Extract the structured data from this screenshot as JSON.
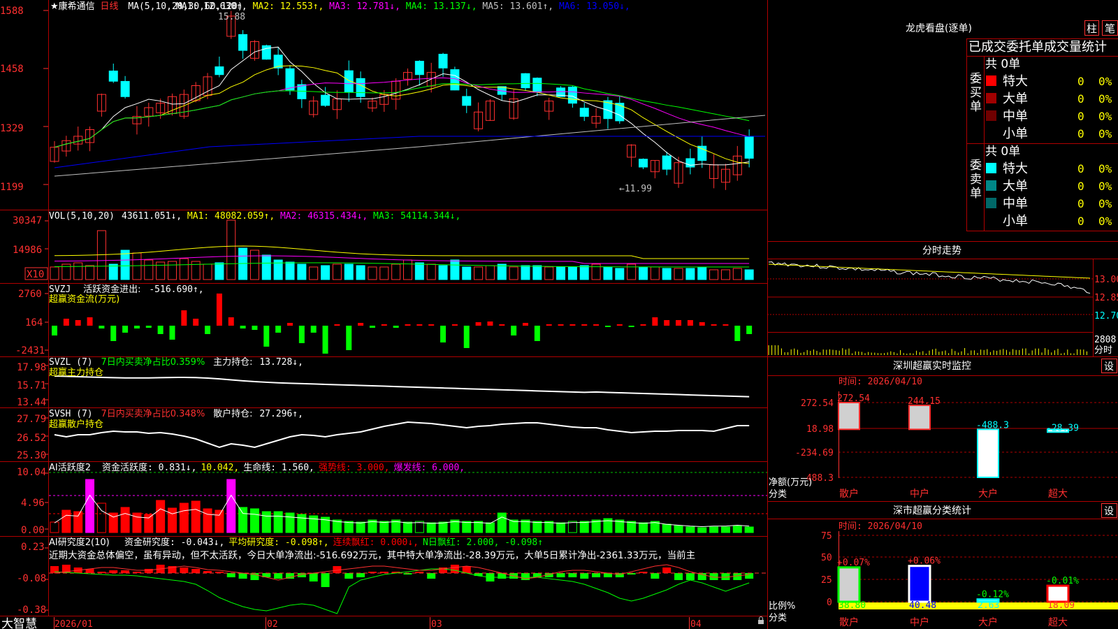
{
  "colors": {
    "up": "#ff3030",
    "down": "#00ffff",
    "grid": "#b00000",
    "bg": "#000000"
  },
  "header": {
    "stock_name": "★康希通信",
    "period": "日线",
    "ma_title": "MA(5,10,20,30,60,120)",
    "ma": [
      {
        "label": "MA1:",
        "value": "12.630↑",
        "color": "#ffffff"
      },
      {
        "label": "MA2:",
        "value": "12.553↑",
        "color": "#ffff00"
      },
      {
        "label": "MA3:",
        "value": "12.781↓",
        "color": "#ff00ff"
      },
      {
        "label": "MA4:",
        "value": "13.137↓",
        "color": "#00ff00"
      },
      {
        "label": "MA5:",
        "value": "13.601↑",
        "color": "#c0c0c0"
      },
      {
        "label": "MA6:",
        "value": "13.050↓",
        "color": "#0000ff"
      }
    ]
  },
  "price_axis": [
    "1588",
    "1458",
    "1329",
    "1199"
  ],
  "price_annotations": {
    "high": "15.88",
    "low": "←11.99"
  },
  "vol": {
    "axis": [
      "30347",
      "14986"
    ],
    "scale": "X10",
    "title": "VOL(5,10,20)",
    "value": "43611.051↓",
    "ma": [
      {
        "label": "MA1:",
        "value": "48082.059↑",
        "color": "#ffff00"
      },
      {
        "label": "MA2:",
        "value": "46315.434↓",
        "color": "#ff00ff"
      },
      {
        "label": "MA3:",
        "value": "54114.344↓",
        "color": "#00ff00"
      }
    ]
  },
  "svzj": {
    "axis": [
      "2760",
      "164",
      "-2431"
    ],
    "title": "SVZJ",
    "label": "活跃资金进出:",
    "value": "-516.690↑,",
    "subtitle": "超赢资金流(万元)"
  },
  "svzl": {
    "axis": [
      "17.98",
      "15.71",
      "13.44"
    ],
    "title": "SVZL (7)",
    "ratio": "7日内买卖净占比0.359%",
    "label": "主力持仓:",
    "value": "13.728↓,",
    "subtitle": "超赢主力持仓"
  },
  "svsh": {
    "axis": [
      "27.79",
      "26.52",
      "25.30"
    ],
    "title": "SVSH (7)",
    "ratio": "7日内买卖净占比0.348%",
    "label": "散户持仓:",
    "value": "27.296↑,",
    "subtitle": "超赢散户持仓"
  },
  "ai_active": {
    "axis": [
      "10.04",
      "4.96",
      "0.00"
    ],
    "title": "AI活跃度2",
    "items": [
      {
        "text": "资金活跃度: 0.831↓,",
        "color": "#ffffff"
      },
      {
        "text": "10.042,",
        "color": "#ffff00"
      },
      {
        "text": "生命线: 1.560,",
        "color": "#ffffff"
      },
      {
        "text": "强势线: 3.000,",
        "color": "#ff0000"
      },
      {
        "text": "爆发线: 6.000,",
        "color": "#ff00ff"
      }
    ]
  },
  "ai_research": {
    "axis": [
      "0.23",
      "-0.08",
      "-0.38"
    ],
    "title": "AI研究度2(10)",
    "items": [
      {
        "text": "资金研究度: -0.043↓,",
        "color": "#ffffff"
      },
      {
        "text": "平均研究度: -0.098↑,",
        "color": "#ffff00"
      },
      {
        "text": "连续飘红: 0.000↓,",
        "color": "#ff0000"
      },
      {
        "text": "N日飘红: 2.000, -0.098↑",
        "color": "#00ff00"
      }
    ],
    "commentary": "近期大资金总体偏空，虽有异动，但不太活跃，今日大单净流出:-516.692万元，其中特大单净流出:-28.39万元，大单5日累计净出-2361.33万元，当前主"
  },
  "bottom_bar": {
    "logo": "大智慧",
    "dates": [
      "2026/01",
      "02",
      "03",
      "04"
    ]
  },
  "dragon": {
    "title": "龙虎看盘(逐单)",
    "btn_col": "柱",
    "btn_stroke": "笔",
    "header": "已成交委托单成交量统计",
    "buy": {
      "side": "委买单",
      "total": "共 0单",
      "rows": [
        {
          "label": "特大",
          "count": "0",
          "pct": "0%",
          "color": "#ff0000"
        },
        {
          "label": "大单",
          "count": "0",
          "pct": "0%",
          "color": "#a00000"
        },
        {
          "label": "中单",
          "count": "0",
          "pct": "0%",
          "color": "#700000"
        },
        {
          "label": "小单",
          "count": "0",
          "pct": "0%",
          "color": ""
        }
      ]
    },
    "sell": {
      "side": "委卖单",
      "total": "共 0单",
      "rows": [
        {
          "label": "特大",
          "count": "0",
          "pct": "0%",
          "color": "#00ffff"
        },
        {
          "label": "大单",
          "count": "0",
          "pct": "0%",
          "color": "#008888"
        },
        {
          "label": "中单",
          "count": "0",
          "pct": "0%",
          "color": "#006868"
        },
        {
          "label": "小单",
          "count": "0",
          "pct": "0%",
          "color": ""
        }
      ]
    }
  },
  "intraday": {
    "title": "分时走势",
    "axis": [
      "13.00",
      "12.85",
      "12.70"
    ],
    "vol_axis": [
      "2808",
      "分时"
    ]
  },
  "sz_monitor": {
    "title": "深圳超赢实时监控",
    "settings": "设",
    "time": "时间: 2026/04/10",
    "axis": [
      "272.54",
      "18.98",
      "-234.69",
      "-488.3"
    ],
    "unit_label": "净额(万元)",
    "category_label": "分类",
    "chart_data": {
      "type": "bar",
      "categories": [
        "散户",
        "中户",
        "大户",
        "超大"
      ],
      "values": [
        272.54,
        244.15,
        -488.3,
        -28.39
      ],
      "value_labels": [
        "272.54",
        "244.15",
        "-488.3",
        "-28.39"
      ],
      "ylim": [
        -488.3,
        272.54
      ]
    }
  },
  "sz_class": {
    "title": "深市超赢分类统计",
    "settings": "设",
    "time": "时间: 2026/04/10",
    "axis": [
      "75",
      "50",
      "25",
      "0"
    ],
    "ratio_label": "比例%",
    "category_label": "分类",
    "chart_data": {
      "type": "bar",
      "categories": [
        "散户",
        "中户",
        "大户",
        "超大"
      ],
      "values": [
        38.8,
        40.48,
        2.63,
        18.09
      ],
      "changes": [
        "+0.07%",
        "+0.06%",
        "-0.12%",
        "-0.01%"
      ],
      "value_labels": [
        "38.80",
        "40.48",
        "2.63",
        "18.09"
      ],
      "ylim": [
        0,
        75
      ]
    }
  }
}
